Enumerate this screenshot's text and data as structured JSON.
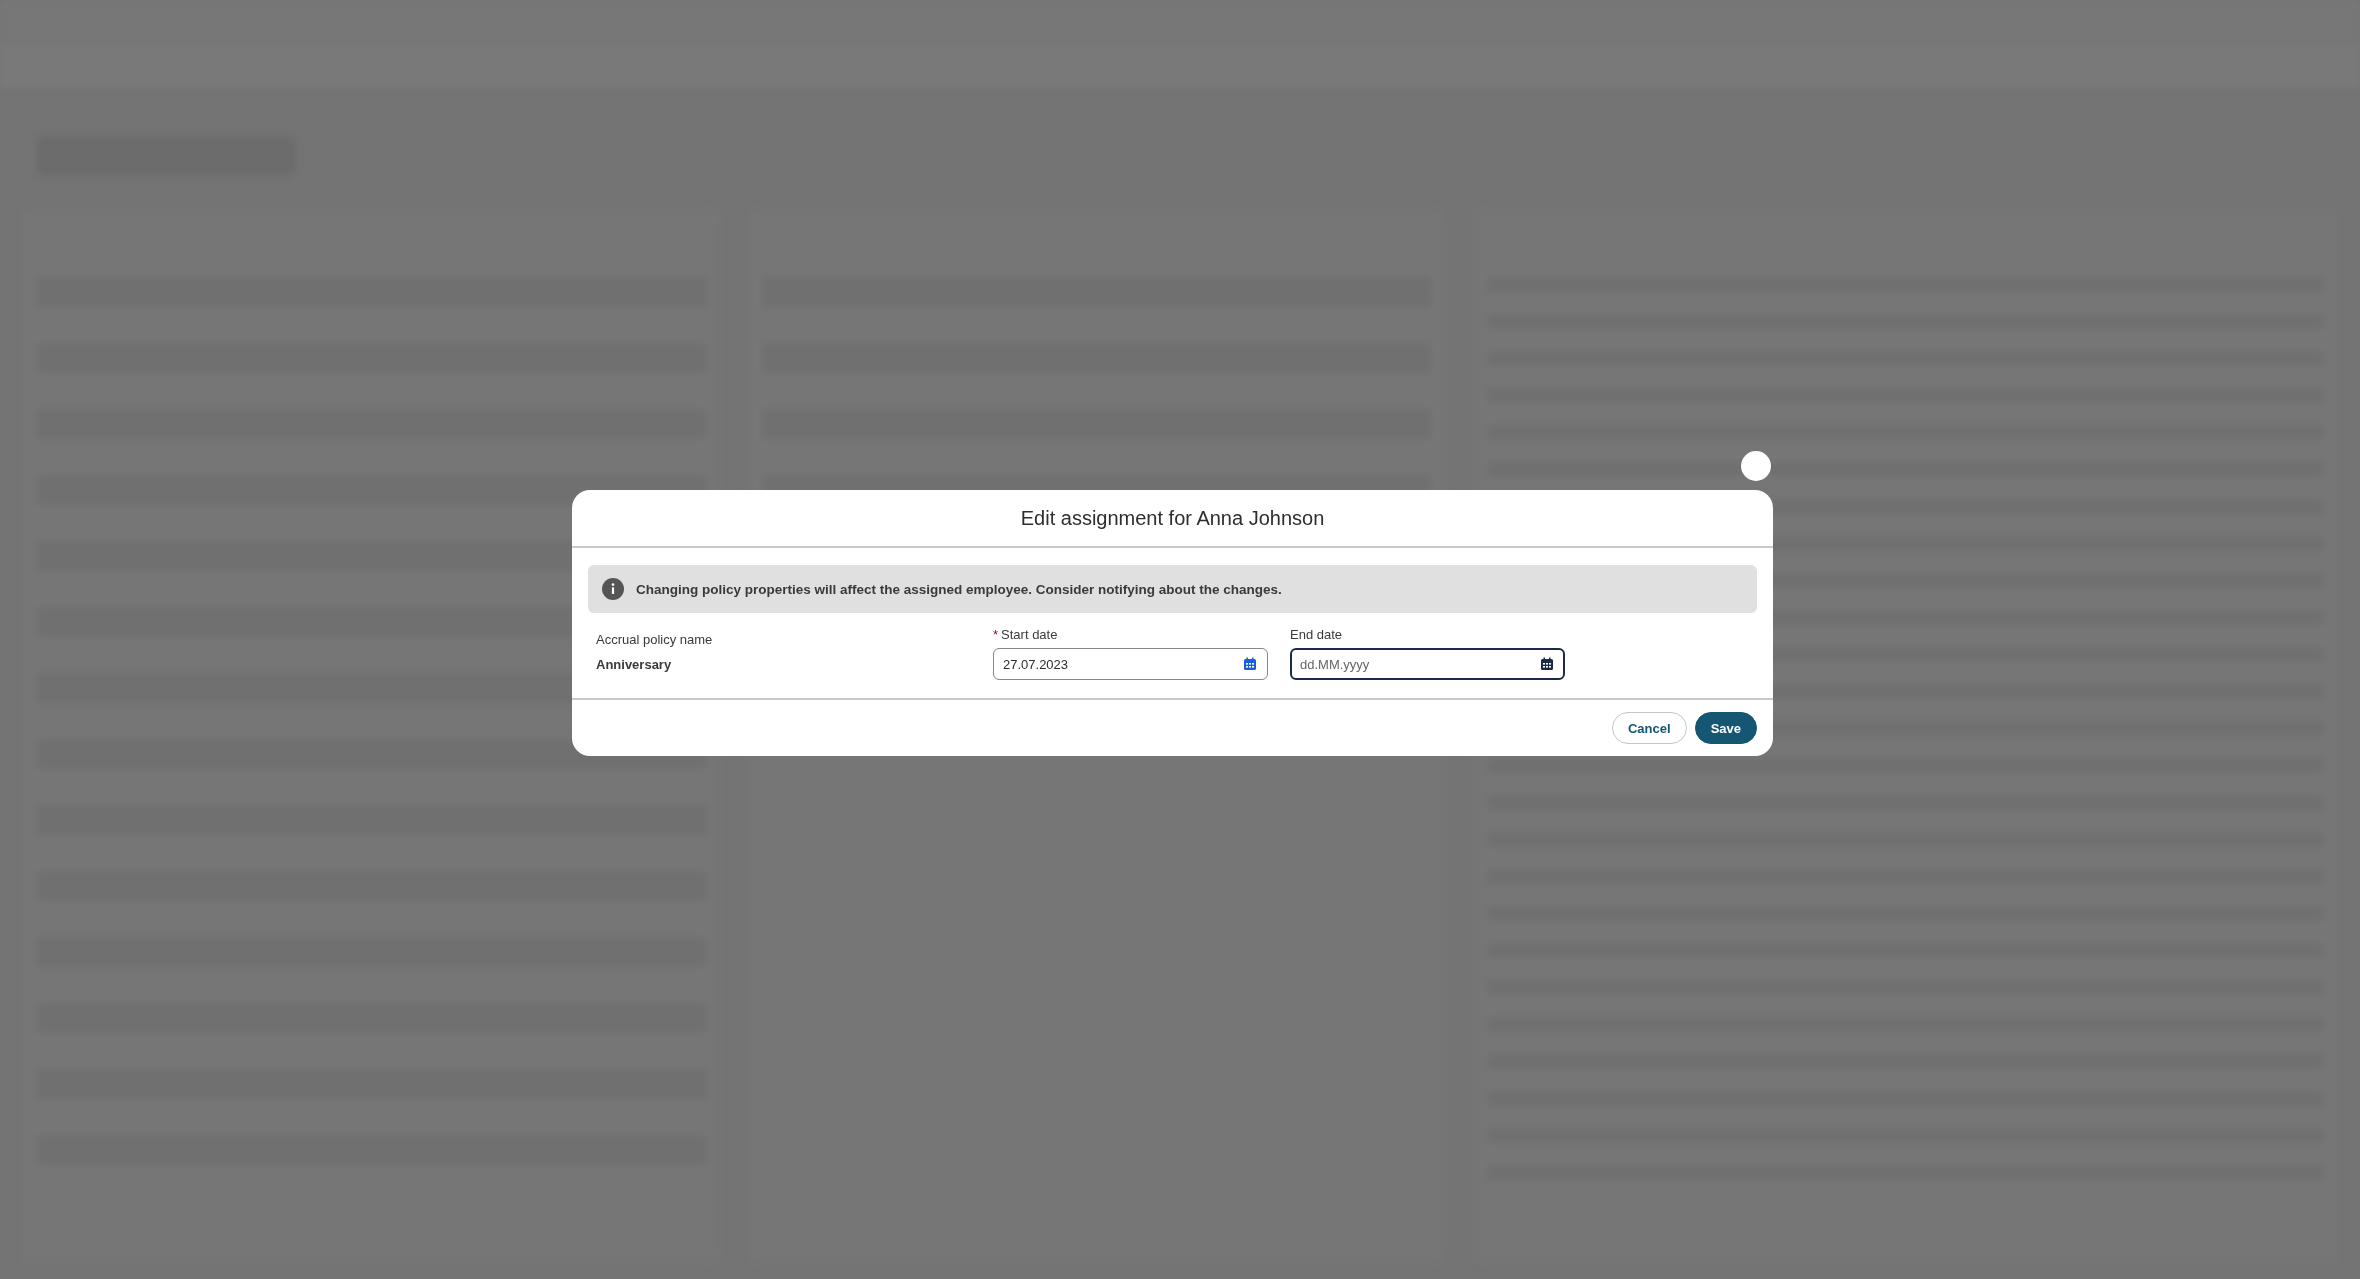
{
  "dialog": {
    "title": "Edit assignment for Anna Johnson",
    "notice": "Changing policy properties will affect the assigned employee. Consider notifying about the changes.",
    "fields": [
      {
        "kind": "readonly",
        "label": "Accrual policy name",
        "value": "Anniversary"
      },
      {
        "kind": "date",
        "label": "Start date",
        "required_marker": "*",
        "value": "27.07.2023",
        "focused": false
      },
      {
        "kind": "date",
        "label": "End date",
        "placeholder": "dd.MM.yyyy",
        "focused": true
      }
    ],
    "buttons": [
      {
        "label": "Cancel",
        "kind": "secondary"
      },
      {
        "label": "Save",
        "kind": "primary"
      }
    ]
  }
}
